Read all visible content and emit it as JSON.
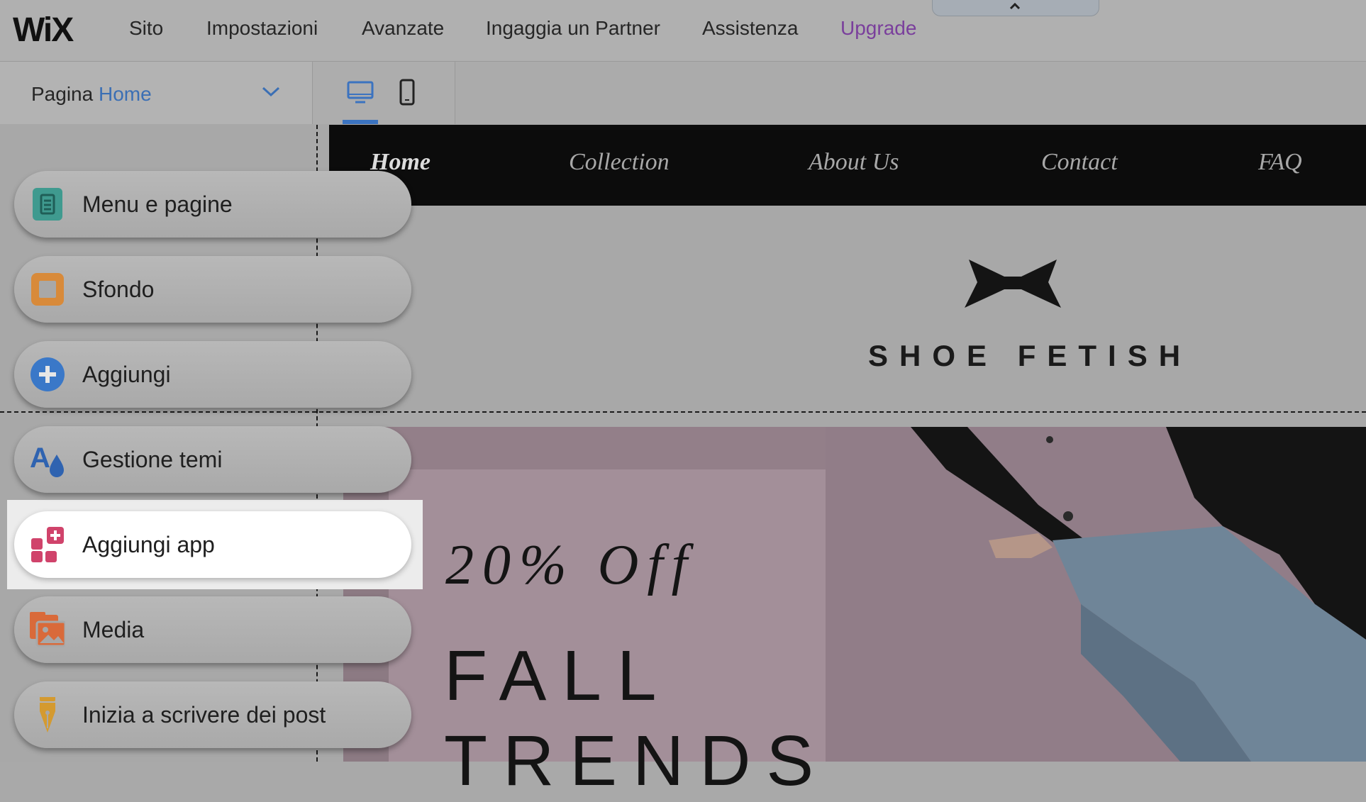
{
  "topbar": {
    "logo_text": "WiX",
    "menu": [
      {
        "label": "Sito"
      },
      {
        "label": "Impostazioni"
      },
      {
        "label": "Avanzate"
      },
      {
        "label": "Ingaggia un Partner"
      },
      {
        "label": "Assistenza"
      },
      {
        "label": "Upgrade"
      }
    ]
  },
  "pagebar": {
    "prefix": "Pagina",
    "current_page": "Home",
    "devices": [
      "desktop-icon",
      "mobile-icon"
    ],
    "active_device": "desktop"
  },
  "site": {
    "nav": [
      {
        "label": "Home"
      },
      {
        "label": "Collection"
      },
      {
        "label": "About Us"
      },
      {
        "label": "Contact"
      },
      {
        "label": "FAQ"
      }
    ],
    "brand_name": "SHOE FETISH",
    "hero": {
      "offer": "20% Off",
      "title_line1": "FALL",
      "title_line2": "TRENDS"
    }
  },
  "sidebar": {
    "items": [
      {
        "label": "Menu e pagine",
        "icon": "pages-icon",
        "color": "#3f9a8f"
      },
      {
        "label": "Sfondo",
        "icon": "background-icon",
        "color": "#d88a3a"
      },
      {
        "label": "Aggiungi",
        "icon": "add-icon",
        "color": "#3a78c8"
      },
      {
        "label": "Gestione temi",
        "icon": "theme-icon",
        "color": "#2f63b0"
      },
      {
        "label": "Aggiungi app",
        "icon": "add-app-icon",
        "color": "#d0436b"
      },
      {
        "label": "Media",
        "icon": "media-icon",
        "color": "#d96a3a"
      },
      {
        "label": "Inizia a scrivere dei post",
        "icon": "pen-icon",
        "color": "#d49a30"
      }
    ],
    "active_item": "Aggiungi app"
  },
  "colors": {
    "accent_blue": "#3b73c0",
    "upgrade_purple": "#7a3f9c",
    "nav_bg": "#0c0c0c",
    "hero_bg": "#937f89"
  }
}
